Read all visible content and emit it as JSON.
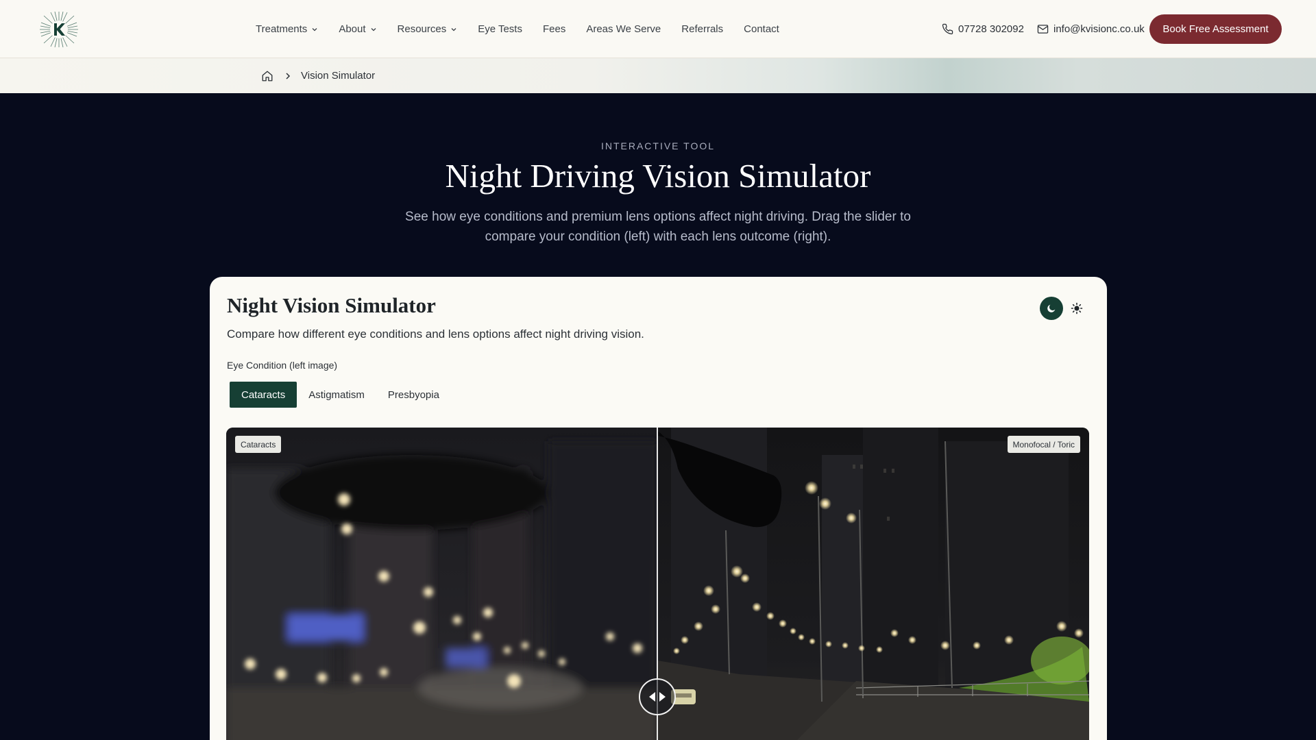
{
  "header": {
    "nav": [
      {
        "label": "Treatments",
        "has_dropdown": true
      },
      {
        "label": "About",
        "has_dropdown": true
      },
      {
        "label": "Resources",
        "has_dropdown": true
      },
      {
        "label": "Eye Tests",
        "has_dropdown": false
      },
      {
        "label": "Fees",
        "has_dropdown": false
      },
      {
        "label": "Areas We Serve",
        "has_dropdown": false
      },
      {
        "label": "Referrals",
        "has_dropdown": false
      },
      {
        "label": "Contact",
        "has_dropdown": false
      }
    ],
    "phone": "07728 302092",
    "email": "info@kvisionc.co.uk",
    "cta_label": "Book Free Assessment"
  },
  "breadcrumb": {
    "current": "Vision Simulator"
  },
  "hero": {
    "eyebrow": "INTERACTIVE TOOL",
    "title": "Night Driving Vision Simulator",
    "subtitle": "See how eye conditions and premium lens options affect night driving. Drag the slider to compare your condition (left) with each lens outcome (right)."
  },
  "simulator": {
    "title": "Night Vision Simulator",
    "description": "Compare how different eye conditions and lens options affect night driving vision.",
    "condition_label": "Eye Condition (left image)",
    "conditions": [
      {
        "label": "Cataracts",
        "active": true
      },
      {
        "label": "Astigmatism",
        "active": false
      },
      {
        "label": "Presbyopia",
        "active": false
      }
    ],
    "left_badge": "Cataracts",
    "right_badge": "Monofocal / Toric",
    "slider_position": 0.5,
    "theme": "night"
  },
  "colors": {
    "brand_green": "#163f34",
    "cta_red": "#7b2a30",
    "hero_bg": "#070b1c",
    "card_bg": "#fbfaf5"
  }
}
